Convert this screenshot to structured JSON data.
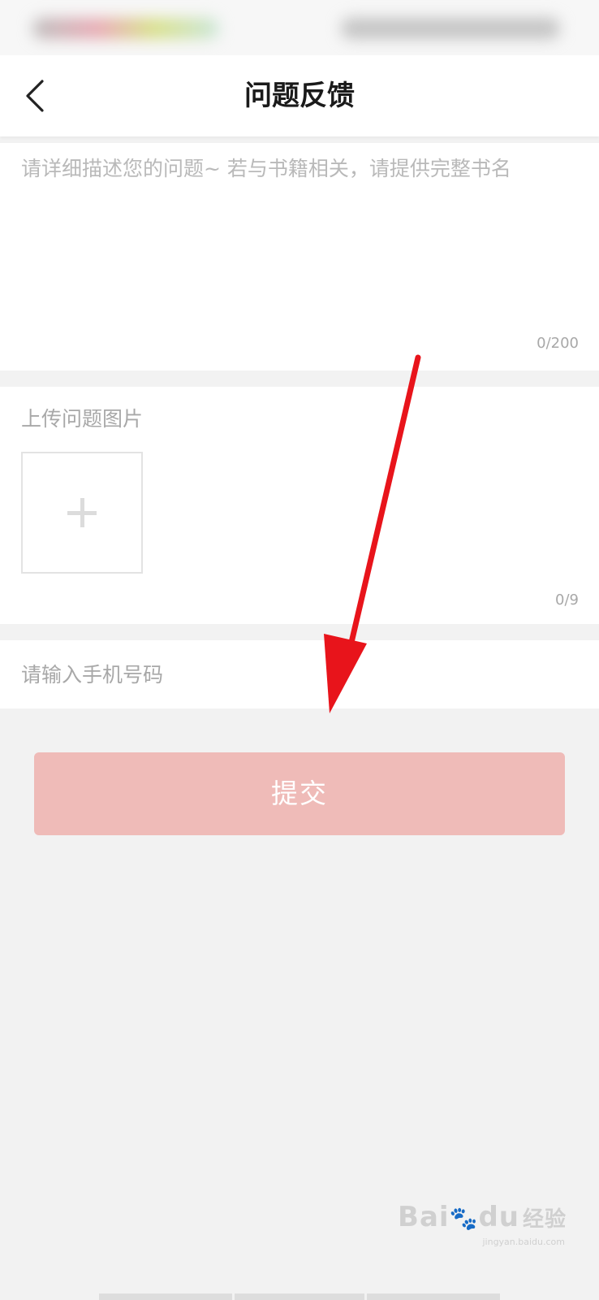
{
  "header": {
    "title": "问题反馈",
    "back_icon": "chevron-left-icon"
  },
  "description": {
    "placeholder": "请详细描述您的问题~ 若与书籍相关，请提供完整书名",
    "value": "",
    "counter": "0/200"
  },
  "upload": {
    "label": "上传问题图片",
    "add_icon": "plus-icon",
    "counter": "0/9"
  },
  "phone": {
    "placeholder": "请输入手机号码",
    "value": ""
  },
  "submit": {
    "label": "提交"
  },
  "watermark": {
    "brand": "Bai",
    "brand_suffix": "du",
    "brand_cn": "经验",
    "url": "jingyan.baidu.com"
  },
  "colors": {
    "page_bg": "#f2f2f2",
    "submit_bg": "#efbbb8",
    "annotation_arrow": "#e8141b"
  }
}
